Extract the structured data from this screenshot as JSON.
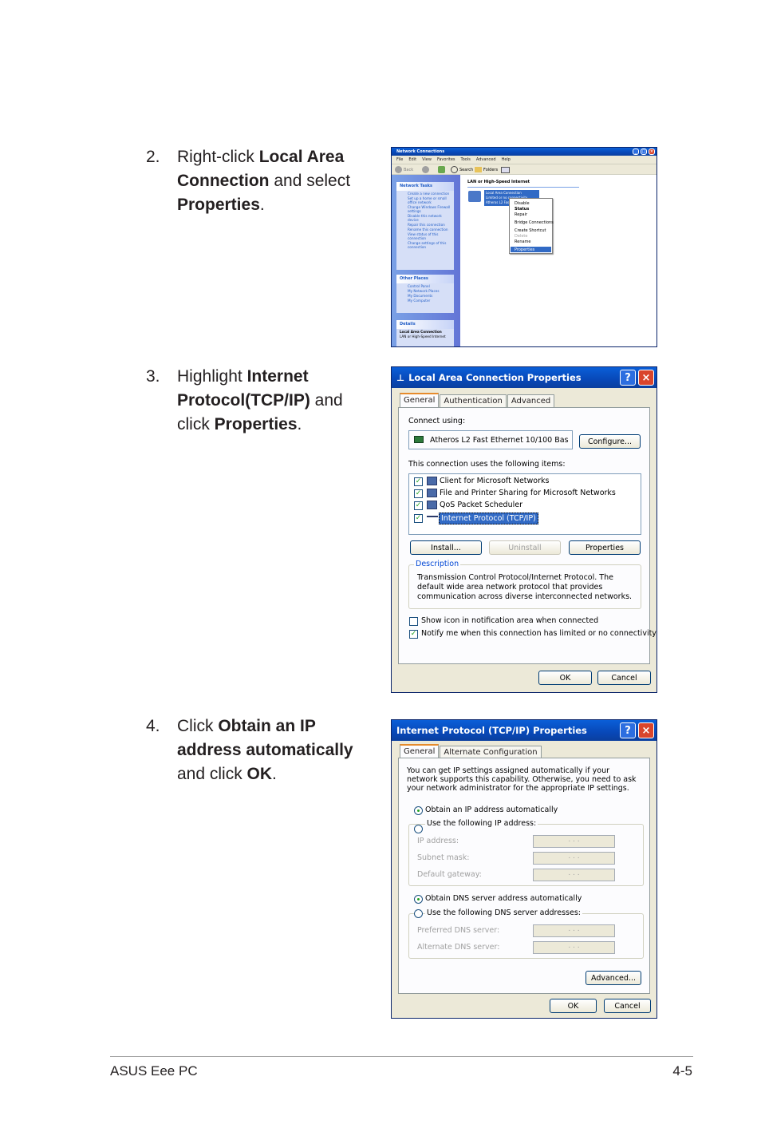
{
  "steps": [
    {
      "num": "2.",
      "pre": "Right-click ",
      "b1": "Local Area Connection",
      "mid": " and select ",
      "b2": "Properties",
      "post": "."
    },
    {
      "num": "3.",
      "pre": "Highlight ",
      "b1": "Internet Protocol(TCP/IP)",
      "mid": " and click ",
      "b2": "Properties",
      "post": "."
    },
    {
      "num": "4.",
      "pre": "Click ",
      "b1": "Obtain an IP address automatically",
      "mid": " and click ",
      "b2": "OK",
      "post": "."
    }
  ],
  "netconn": {
    "title": "Network Connections",
    "menu": [
      "File",
      "Edit",
      "View",
      "Favorites",
      "Tools",
      "Advanced",
      "Help"
    ],
    "back": "Back",
    "search": "Search",
    "folders": "Folders",
    "section_header": "LAN or High-Speed Internet",
    "network_tasks_header": "Network Tasks",
    "network_tasks": [
      "Create a new connection",
      "Set up a home or small office network",
      "Change Windows Firewall settings",
      "Disable this network device",
      "Repair this connection",
      "Rename this connection",
      "View status of this connection",
      "Change settings of this connection"
    ],
    "other_places_header": "Other Places",
    "other_places": [
      "Control Panel",
      "My Network Places",
      "My Documents",
      "My Computer"
    ],
    "details_header": "Details",
    "details_name": "Local Area Connection",
    "details_type": "LAN or High-Speed Internet",
    "item_name": "Local Area Connection",
    "item_status": "Limited or no connectivity",
    "item_device": "Atheros L2 Fast Ethernet",
    "context_menu": [
      "Disable",
      "Status",
      "Repair",
      "Bridge Connections",
      "Create Shortcut",
      "Delete",
      "Rename",
      "Properties"
    ]
  },
  "lac": {
    "title": "Local Area Connection Properties",
    "tabs": [
      "General",
      "Authentication",
      "Advanced"
    ],
    "connect_using": "Connect using:",
    "adapter": "Atheros L2 Fast Ethernet 10/100 Bas",
    "configure": "Configure...",
    "items_label": "This connection uses the following items:",
    "items": [
      "Client for Microsoft Networks",
      "File and Printer Sharing for Microsoft Networks",
      "QoS Packet Scheduler",
      "Internet Protocol (TCP/IP)"
    ],
    "install": "Install...",
    "uninstall": "Uninstall",
    "properties": "Properties",
    "description_label": "Description",
    "description": "Transmission Control Protocol/Internet Protocol. The default wide area network protocol that provides communication across diverse interconnected networks.",
    "show_icon": "Show icon in notification area when connected",
    "notify": "Notify me when this connection has limited or no connectivity",
    "ok": "OK",
    "cancel": "Cancel"
  },
  "tcp": {
    "title": "Internet Protocol (TCP/IP) Properties",
    "tabs": [
      "General",
      "Alternate Configuration"
    ],
    "intro": "You can get IP settings assigned automatically if your network supports this capability. Otherwise, you need to ask your network administrator for the appropriate IP settings.",
    "obtain_ip": "Obtain an IP address automatically",
    "use_ip": "Use the following IP address:",
    "ip_address": "IP address:",
    "subnet": "Subnet mask:",
    "gateway": "Default gateway:",
    "obtain_dns": "Obtain DNS server address automatically",
    "use_dns": "Use the following DNS server addresses:",
    "pref_dns": "Preferred DNS server:",
    "alt_dns": "Alternate DNS server:",
    "ip_placeholder": ".       .       .",
    "advanced": "Advanced...",
    "ok": "OK",
    "cancel": "Cancel"
  },
  "footer": {
    "left": "ASUS Eee PC",
    "right": "4-5"
  }
}
